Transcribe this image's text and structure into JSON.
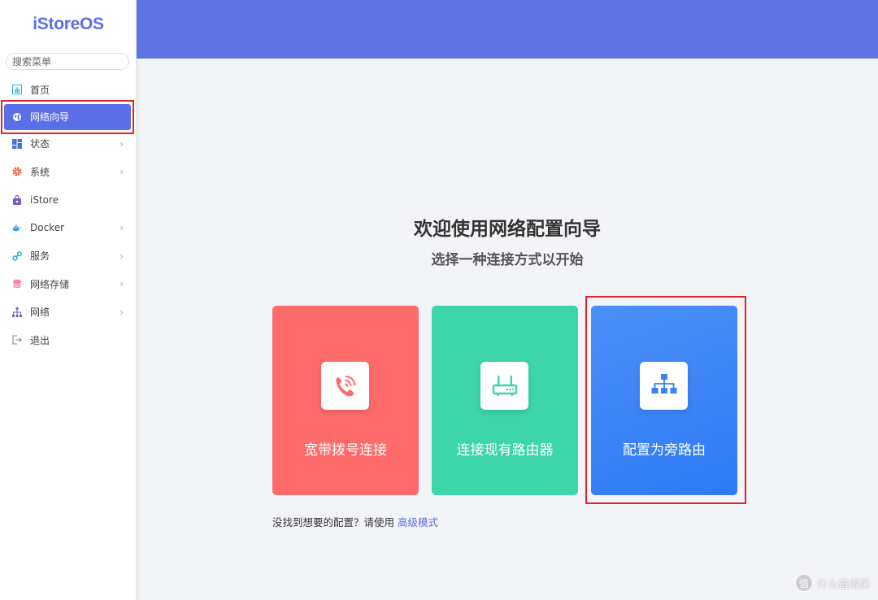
{
  "app": {
    "logo": "iStoreOS"
  },
  "search": {
    "placeholder": "搜索菜单"
  },
  "sidebar": {
    "items": [
      {
        "label": "首页",
        "icon": "home-icon",
        "chevron": false
      },
      {
        "label": "网络向导",
        "icon": "globe-icon",
        "chevron": false,
        "active": true
      },
      {
        "label": "状态",
        "icon": "dashboard-icon",
        "chevron": true
      },
      {
        "label": "系统",
        "icon": "gear-icon",
        "chevron": true
      },
      {
        "label": "iStore",
        "icon": "store-bag-icon",
        "chevron": false
      },
      {
        "label": "Docker",
        "icon": "docker-icon",
        "chevron": true
      },
      {
        "label": "服务",
        "icon": "services-icon",
        "chevron": true
      },
      {
        "label": "网络存储",
        "icon": "storage-icon",
        "chevron": true
      },
      {
        "label": "网络",
        "icon": "network-icon",
        "chevron": true
      },
      {
        "label": "退出",
        "icon": "logout-icon",
        "chevron": false
      }
    ],
    "chevron_glyph": "›"
  },
  "main": {
    "title": "欢迎使用网络配置向导",
    "subtitle": "选择一种连接方式以开始",
    "cards": [
      {
        "label": "宽带拨号连接",
        "icon": "phone-icon",
        "color": "#ff6b6b"
      },
      {
        "label": "连接现有路由器",
        "icon": "router-icon",
        "color": "#3dd5aa"
      },
      {
        "label": "配置为旁路由",
        "icon": "network-tree-icon",
        "color": "#3a82f7"
      }
    ],
    "hint_text": "没找到想要的配置？请使用 ",
    "hint_link": "高级模式"
  },
  "watermark": {
    "text": "什么值得买",
    "icon": "zhi-icon",
    "icon_glyph": "值"
  },
  "colors": {
    "accent": "#5b6fe6",
    "topbar": "#6073e3",
    "highlight_outline": "#e0262d"
  }
}
